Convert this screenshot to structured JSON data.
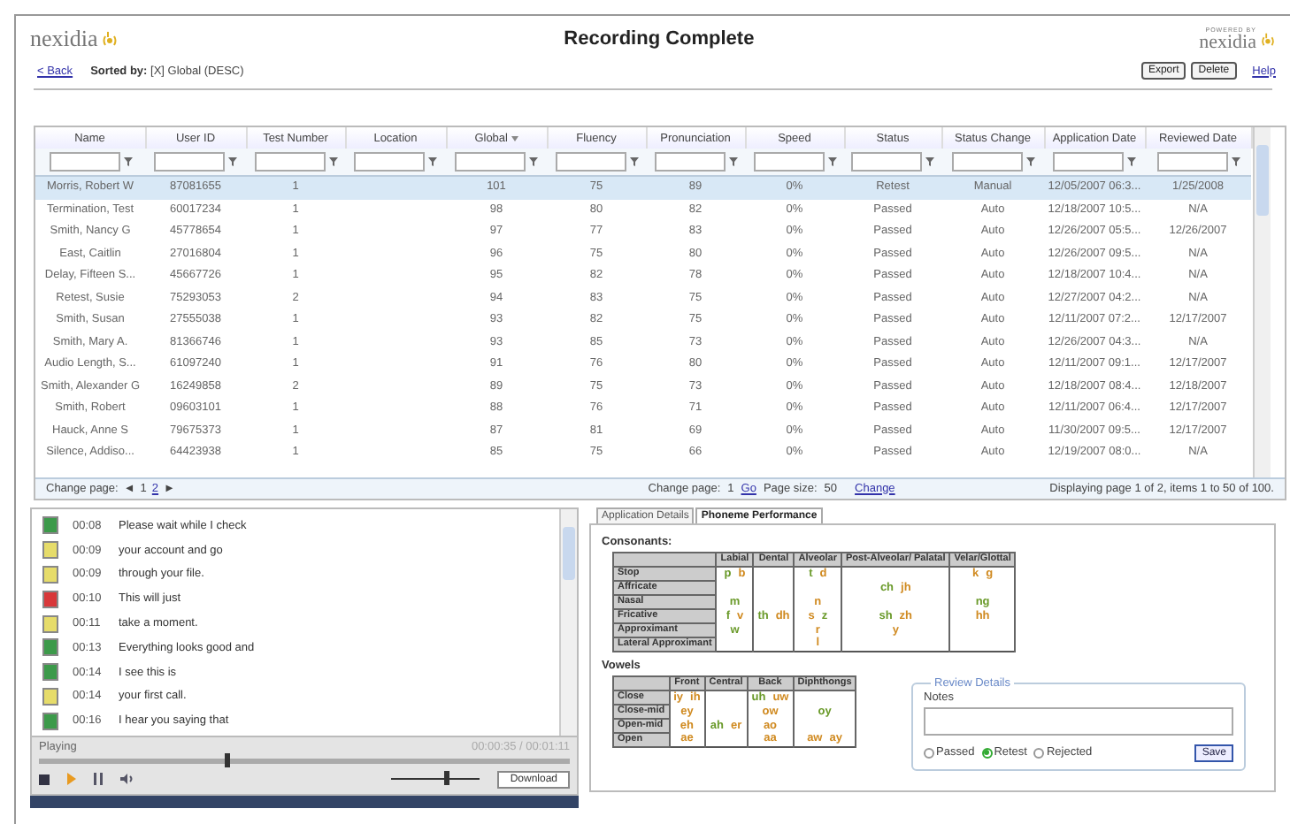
{
  "header": {
    "logo": "nexidia",
    "title": "Recording Complete",
    "powered_by": "POWERED BY",
    "partner_logo": "nexidia",
    "back": "< Back",
    "sorted_by_label": "Sorted by:",
    "sorted_by_value": "[X] Global (DESC)",
    "buttons": [
      "Export",
      "Delete"
    ],
    "help": "Help"
  },
  "table": {
    "columns": [
      {
        "label": "Name",
        "sorted": false
      },
      {
        "label": "User ID",
        "sorted": false
      },
      {
        "label": "Test Number",
        "sorted": false
      },
      {
        "label": "Location",
        "sorted": false
      },
      {
        "label": "Global",
        "sorted": true
      },
      {
        "label": "Fluency",
        "sorted": false
      },
      {
        "label": "Pronunciation",
        "sorted": false
      },
      {
        "label": "Speed",
        "sorted": false
      },
      {
        "label": "Status",
        "sorted": false
      },
      {
        "label": "Status Change",
        "sorted": false
      },
      {
        "label": "Application Date",
        "sorted": false
      },
      {
        "label": "Reviewed Date",
        "sorted": false
      }
    ],
    "rows": [
      {
        "selected": true,
        "cells": [
          "Morris, Robert W",
          "87081655",
          "1",
          "",
          "101",
          "75",
          "89",
          "0%",
          "Retest",
          "Manual",
          "12/05/2007 06:3...",
          "1/25/2008"
        ]
      },
      {
        "selected": false,
        "cells": [
          "Termination, Test",
          "60017234",
          "1",
          "",
          "98",
          "80",
          "82",
          "0%",
          "Passed",
          "Auto",
          "12/18/2007 10:5...",
          "N/A"
        ]
      },
      {
        "selected": false,
        "cells": [
          "Smith, Nancy G",
          "45778654",
          "1",
          "",
          "97",
          "77",
          "83",
          "0%",
          "Passed",
          "Auto",
          "12/26/2007 05:5...",
          "12/26/2007"
        ]
      },
      {
        "selected": false,
        "cells": [
          "East, Caitlin",
          "27016804",
          "1",
          "",
          "96",
          "75",
          "80",
          "0%",
          "Passed",
          "Auto",
          "12/26/2007 09:5...",
          "N/A"
        ]
      },
      {
        "selected": false,
        "cells": [
          "Delay, Fifteen S...",
          "45667726",
          "1",
          "",
          "95",
          "82",
          "78",
          "0%",
          "Passed",
          "Auto",
          "12/18/2007 10:4...",
          "N/A"
        ]
      },
      {
        "selected": false,
        "cells": [
          "Retest, Susie",
          "75293053",
          "2",
          "",
          "94",
          "83",
          "75",
          "0%",
          "Passed",
          "Auto",
          "12/27/2007 04:2...",
          "N/A"
        ]
      },
      {
        "selected": false,
        "cells": [
          "Smith, Susan",
          "27555038",
          "1",
          "",
          "93",
          "82",
          "75",
          "0%",
          "Passed",
          "Auto",
          "12/11/2007 07:2...",
          "12/17/2007"
        ]
      },
      {
        "selected": false,
        "cells": [
          "Smith, Mary A.",
          "81366746",
          "1",
          "",
          "93",
          "85",
          "73",
          "0%",
          "Passed",
          "Auto",
          "12/26/2007 04:3...",
          "N/A"
        ]
      },
      {
        "selected": false,
        "cells": [
          "Audio Length, S...",
          "61097240",
          "1",
          "",
          "91",
          "76",
          "80",
          "0%",
          "Passed",
          "Auto",
          "12/11/2007 09:1...",
          "12/17/2007"
        ]
      },
      {
        "selected": false,
        "cells": [
          "Smith, Alexander G",
          "16249858",
          "2",
          "",
          "89",
          "75",
          "73",
          "0%",
          "Passed",
          "Auto",
          "12/18/2007 08:4...",
          "12/18/2007"
        ]
      },
      {
        "selected": false,
        "cells": [
          "Smith, Robert",
          "09603101",
          "1",
          "",
          "88",
          "76",
          "71",
          "0%",
          "Passed",
          "Auto",
          "12/11/2007 06:4...",
          "12/17/2007"
        ]
      },
      {
        "selected": false,
        "cells": [
          "Hauck, Anne S",
          "79675373",
          "1",
          "",
          "87",
          "81",
          "69",
          "0%",
          "Passed",
          "Auto",
          "11/30/2007 09:5...",
          "12/17/2007"
        ]
      },
      {
        "selected": false,
        "cells": [
          "Silence, Addiso...",
          "64423938",
          "1",
          "",
          "85",
          "75",
          "66",
          "0%",
          "Passed",
          "Auto",
          "12/19/2007 08:0...",
          "N/A"
        ]
      }
    ],
    "pager": {
      "change_page_label": "Change page:",
      "prev": "◄",
      "pages": [
        {
          "label": "1",
          "selected": true
        },
        {
          "label": "2",
          "selected": false
        }
      ],
      "next": "►",
      "goto_label": "Change page:",
      "goto_value": "1",
      "go": "Go",
      "page_size_label": "Page size:",
      "page_size_value": "50",
      "change": "Change",
      "summary": "Displaying page 1 of 2, items 1 to 50 of 100."
    }
  },
  "transcript": {
    "items": [
      {
        "time": "00:08",
        "text": "Please wait while I check",
        "color": "#3c9a4a"
      },
      {
        "time": "00:09",
        "text": "your account and go",
        "color": "#e6dc6a"
      },
      {
        "time": "00:09",
        "text": "through your file.",
        "color": "#e6dc6a"
      },
      {
        "time": "00:10",
        "text": "This will just",
        "color": "#d8383a"
      },
      {
        "time": "00:11",
        "text": "take a moment.",
        "color": "#e6dc6a"
      },
      {
        "time": "00:13",
        "text": "Everything looks good and",
        "color": "#3c9a4a"
      },
      {
        "time": "00:14",
        "text": "I see this is",
        "color": "#3c9a4a"
      },
      {
        "time": "00:14",
        "text": "your first call.",
        "color": "#e6dc6a"
      },
      {
        "time": "00:16",
        "text": "I hear you saying that",
        "color": "#3c9a4a"
      }
    ],
    "player": {
      "status": "Playing",
      "time": "00:00:35 / 00:01:11",
      "level": 0.35,
      "volume": {
        "level": 0.6
      },
      "download": "Download"
    }
  },
  "phoneme_panel": {
    "tabs": [
      {
        "label": "Application Details",
        "selected": false
      },
      {
        "label": "Phoneme Performance",
        "selected": true
      }
    ],
    "consonants": {
      "title": "Consonants:",
      "columns": [
        "Labial",
        "Dental",
        "Alveolar",
        "Post-Alveolar/ Palatal",
        "Velar/Glottal"
      ],
      "rows": [
        {
          "label": "Stop",
          "cells": [
            [
              {
                "symbol": "p",
                "color": "#6a9a2a"
              },
              {
                "symbol": "b",
                "color": "#d08a20"
              }
            ],
            [],
            [
              {
                "symbol": "t",
                "color": "#6a9a2a"
              },
              {
                "symbol": "d",
                "color": "#d08a20"
              }
            ],
            [],
            [
              {
                "symbol": "k",
                "color": "#d08a20"
              },
              {
                "symbol": "g",
                "color": "#d08a20"
              }
            ]
          ]
        },
        {
          "label": "Affricate",
          "cells": [
            [],
            [],
            [],
            [
              {
                "symbol": "ch",
                "color": "#6a9a2a"
              },
              {
                "symbol": "jh",
                "color": "#d08a20"
              }
            ],
            []
          ]
        },
        {
          "label": "Nasal",
          "cells": [
            [
              {
                "symbol": "m",
                "color": "#6a9a2a"
              }
            ],
            [],
            [
              {
                "symbol": "n",
                "color": "#d08a20"
              }
            ],
            [],
            [
              {
                "symbol": "ng",
                "color": "#6a9a2a"
              }
            ]
          ]
        },
        {
          "label": "Fricative",
          "cells": [
            [
              {
                "symbol": "f",
                "color": "#6a9a2a"
              },
              {
                "symbol": "v",
                "color": "#d08a20"
              }
            ],
            [
              {
                "symbol": "th",
                "color": "#6a9a2a"
              },
              {
                "symbol": "dh",
                "color": "#d08a20"
              }
            ],
            [
              {
                "symbol": "s",
                "color": "#d08a20"
              },
              {
                "symbol": "z",
                "color": "#6a9a2a"
              }
            ],
            [
              {
                "symbol": "sh",
                "color": "#6a9a2a"
              },
              {
                "symbol": "zh",
                "color": "#d08a20"
              }
            ],
            [
              {
                "symbol": "hh",
                "color": "#d08a20"
              }
            ]
          ]
        },
        {
          "label": "Approximant",
          "cells": [
            [
              {
                "symbol": "w",
                "color": "#6a9a2a"
              }
            ],
            [],
            [
              {
                "symbol": "r",
                "color": "#d08a20"
              }
            ],
            [
              {
                "symbol": "y",
                "color": "#d08a20"
              }
            ],
            []
          ]
        },
        {
          "label": "Lateral Approximant",
          "cells": [
            [],
            [],
            [
              {
                "symbol": "l",
                "color": "#d08a20"
              }
            ],
            [],
            []
          ]
        }
      ]
    },
    "vowels": {
      "title": "Vowels",
      "columns": [
        "Front",
        "Central",
        "Back",
        "Diphthongs"
      ],
      "rows": [
        {
          "label": "Close",
          "cells": [
            [
              {
                "symbol": "iy",
                "color": "#d08a20"
              },
              {
                "symbol": "ih",
                "color": "#d08a20"
              }
            ],
            [],
            [
              {
                "symbol": "uh",
                "color": "#6a9a2a"
              },
              {
                "symbol": "uw",
                "color": "#d08a20"
              }
            ],
            []
          ]
        },
        {
          "label": "Close-mid",
          "cells": [
            [
              {
                "symbol": "ey",
                "color": "#d08a20"
              }
            ],
            [],
            [
              {
                "symbol": "ow",
                "color": "#d08a20"
              }
            ],
            [
              {
                "symbol": "oy",
                "color": "#6a9a2a"
              }
            ]
          ]
        },
        {
          "label": "Open-mid",
          "cells": [
            [
              {
                "symbol": "eh",
                "color": "#d08a20"
              }
            ],
            [
              {
                "symbol": "ah",
                "color": "#6a9a2a"
              },
              {
                "symbol": "er",
                "color": "#d08a20"
              }
            ],
            [
              {
                "symbol": "ao",
                "color": "#d08a20"
              }
            ],
            []
          ]
        },
        {
          "label": "Open",
          "cells": [
            [
              {
                "symbol": "ae",
                "color": "#d08a20"
              }
            ],
            [],
            [
              {
                "symbol": "aa",
                "color": "#d08a20"
              }
            ],
            [
              {
                "symbol": "aw",
                "color": "#d08a20"
              },
              {
                "symbol": "ay",
                "color": "#d08a20"
              }
            ]
          ]
        }
      ]
    },
    "review": {
      "legend": "Review Details",
      "notes_label": "Notes",
      "options": [
        {
          "label": "Passed",
          "selected": false
        },
        {
          "label": "Retest",
          "selected": true
        },
        {
          "label": "Rejected",
          "selected": false
        }
      ],
      "save": "Save"
    }
  }
}
